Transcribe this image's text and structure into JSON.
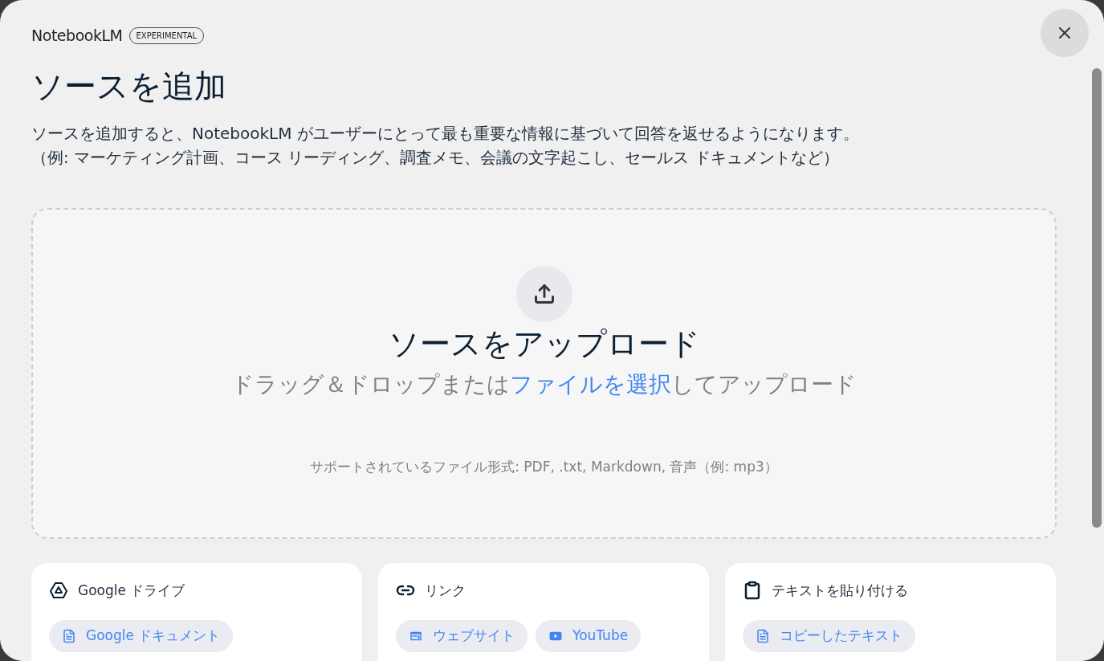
{
  "header": {
    "logo": "NotebookLM",
    "badge": "EXPERIMENTAL"
  },
  "title": "ソースを追加",
  "description": [
    "ソースを追加すると、NotebookLM がユーザーにとって最も重要な情報に基づいて回答を返せるようになります。",
    "（例: マーケティング計画、コース リーディング、調査メモ、会議の文字起こし、セールス ドキュメントなど）"
  ],
  "upload": {
    "title": "ソースをアップロード",
    "hint_before": "ドラッグ＆ドロップまたは",
    "hint_link": "ファイルを選択",
    "hint_after": "してアップロード",
    "formats": "サポートされているファイル形式: PDF, .txt, Markdown, 音声（例: mp3）"
  },
  "sources": [
    {
      "kind": "drive",
      "title": "Google ドライブ",
      "chips": [
        {
          "kind": "doc",
          "label": "Google ドキュメント"
        }
      ]
    },
    {
      "kind": "link",
      "title": "リンク",
      "chips": [
        {
          "kind": "web",
          "label": "ウェブサイト"
        },
        {
          "kind": "video",
          "label": "YouTube"
        }
      ]
    },
    {
      "kind": "clipboard",
      "title": "テキストを貼り付ける",
      "chips": [
        {
          "kind": "doc",
          "label": "コピーしたテキスト"
        }
      ]
    }
  ]
}
